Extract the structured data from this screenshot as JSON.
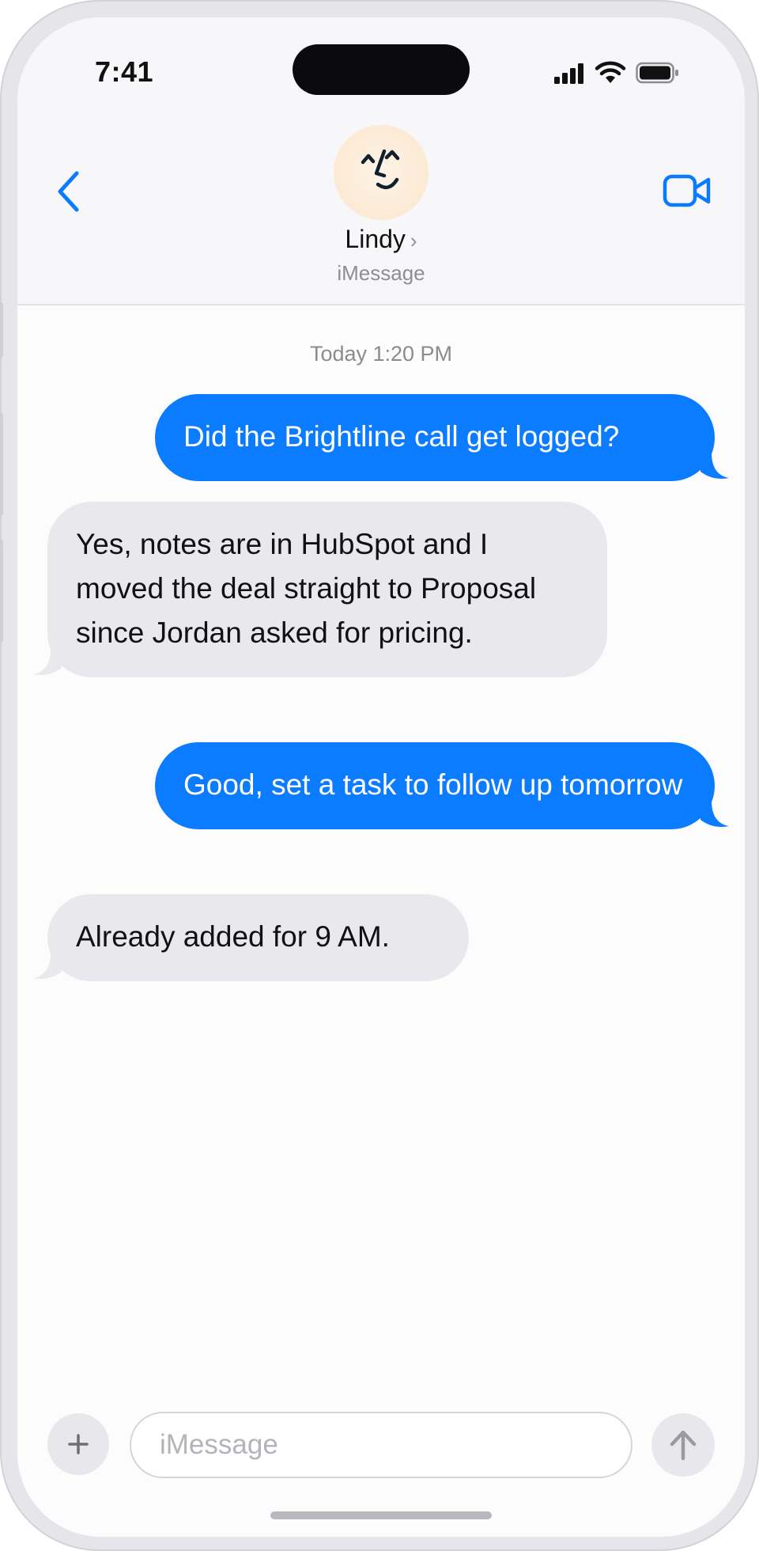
{
  "status_bar": {
    "time": "7:41"
  },
  "header": {
    "contact_name": "Lindy",
    "chevron": "›",
    "service": "iMessage",
    "back_icon": "chevron-left-icon",
    "video_icon": "video-camera-icon"
  },
  "conversation": {
    "timestamp": "Today 1:20 PM",
    "messages": [
      {
        "direction": "outgoing",
        "text": "Did the Brightline call get logged?"
      },
      {
        "direction": "incoming",
        "text": "Yes, notes are in HubSpot and I moved the deal straight to Proposal since Jordan asked for pricing."
      },
      {
        "direction": "outgoing",
        "text": "Good, set a task to follow up tomorrow"
      },
      {
        "direction": "incoming",
        "text": "Already added for 9 AM."
      }
    ]
  },
  "composer": {
    "placeholder": "iMessage",
    "plus_icon": "plus-icon",
    "send_icon": "arrow-up-icon"
  },
  "colors": {
    "outgoing_bubble": "#0b7cff",
    "incoming_bubble": "#e9e8ed",
    "accent": "#0a7aff"
  }
}
